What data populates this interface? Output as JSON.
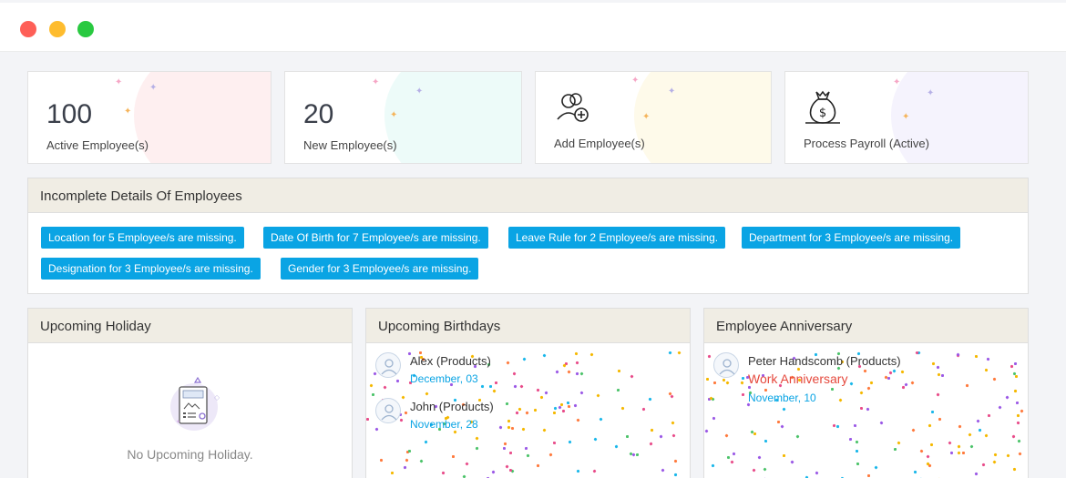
{
  "window": {
    "controls": [
      "close",
      "minimize",
      "maximize"
    ]
  },
  "stats": [
    {
      "number": "100",
      "label": "Active Employee(s)",
      "accent": "#fde2e4"
    },
    {
      "number": "20",
      "label": "New Employee(s)",
      "accent": "#dff7f4"
    },
    {
      "label": "Add Employee(s)",
      "icon": "add-users-icon",
      "accent": "#fdf6d8"
    },
    {
      "label": "Process Payroll (Active)",
      "icon": "money-bag-icon",
      "accent": "#ece9fb"
    }
  ],
  "incomplete": {
    "title": "Incomplete Details Of Employees",
    "items": [
      "Location for 5 Employee/s are missing.",
      "Date Of Birth for 7 Employee/s are missing.",
      "Leave Rule for 2 Employee/s are missing.",
      "Department for 3 Employee/s are missing.",
      "Designation for 3 Employee/s are missing.",
      "Gender for 3 Employee/s are missing."
    ]
  },
  "holiday": {
    "title": "Upcoming Holiday",
    "empty_text": "No Upcoming Holiday.",
    "icon": "calendar-document-icon"
  },
  "birthdays": {
    "title": "Upcoming Birthdays",
    "people": [
      {
        "name": "Alex (Products)",
        "date": "December, 03"
      },
      {
        "name": "John (Products)",
        "date": "November, 28"
      }
    ]
  },
  "anniversary": {
    "title": "Employee Anniversary",
    "people": [
      {
        "name": "Peter Handscomb (Products)",
        "tag": "Work Anniversary",
        "date": "November, 10"
      }
    ]
  },
  "colors": {
    "accent": "#0aa4e4",
    "panel_header": "#f0ede4",
    "anniversary_tag": "#e5483c"
  }
}
